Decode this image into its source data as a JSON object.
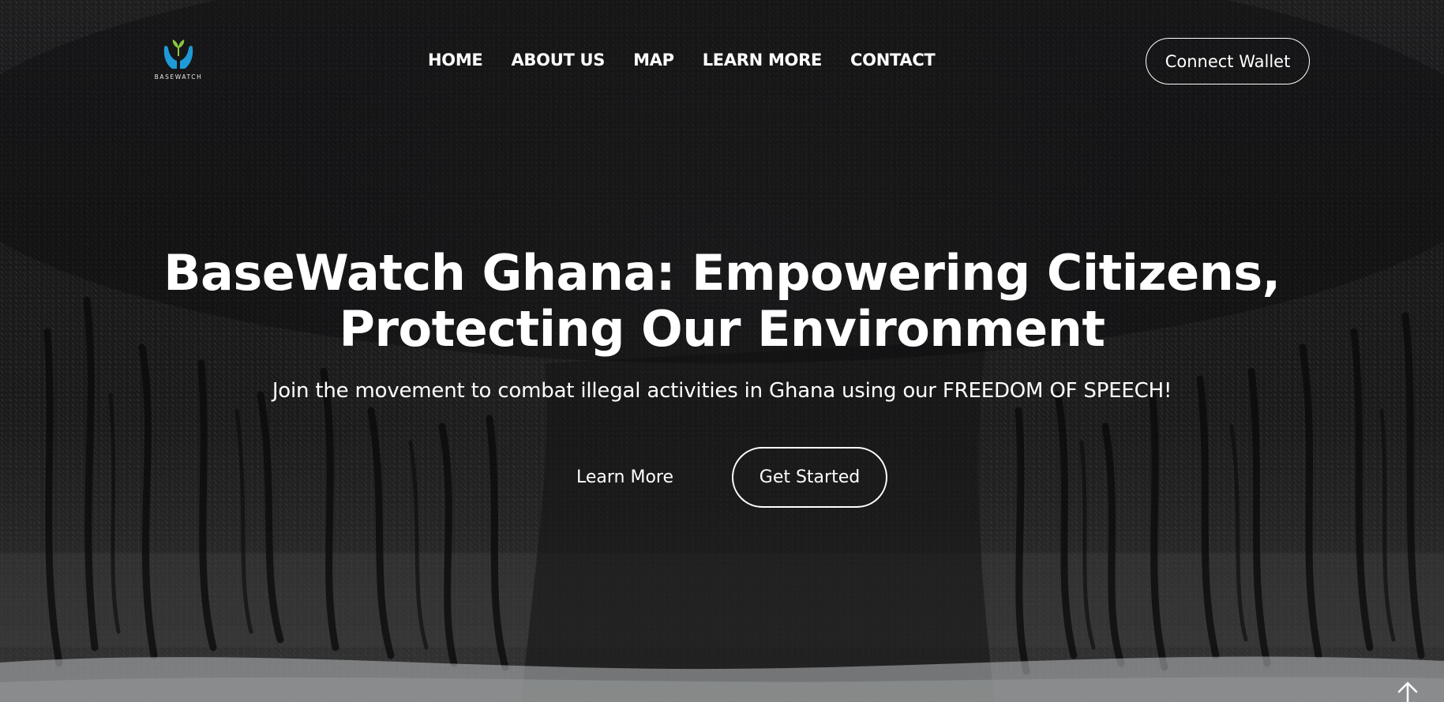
{
  "brand": {
    "logo_text": "BASEWATCH",
    "colors": {
      "hands": "#1e9bd7",
      "sprout": "#8cc63f"
    }
  },
  "nav": {
    "items": [
      {
        "label": "HOME"
      },
      {
        "label": "ABOUT US"
      },
      {
        "label": "MAP"
      },
      {
        "label": "LEARN MORE"
      },
      {
        "label": "CONTACT"
      }
    ]
  },
  "header": {
    "connect_wallet_label": "Connect Wallet"
  },
  "hero": {
    "title_line1": "BaseWatch Ghana: Empowering Citizens,",
    "title_line2": "Protecting Our Environment",
    "subtitle": "Join the movement to combat illegal activities in Ghana using our FREEDOM OF SPEECH!",
    "learn_more_label": "Learn More",
    "get_started_label": "Get Started"
  },
  "icons": {
    "logo": "hands-sprout-icon",
    "back_to_top": "arrow-up-icon"
  }
}
